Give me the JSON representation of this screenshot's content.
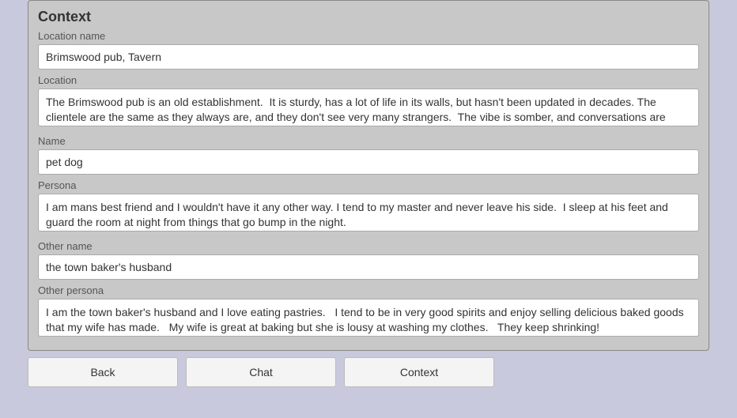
{
  "panel": {
    "title": "Context",
    "fields": {
      "location_name": {
        "label": "Location name",
        "value": "Brimswood pub, Tavern"
      },
      "location": {
        "label": "Location",
        "value": "The Brimswood pub is an old establishment.  It is sturdy, has a lot of life in its walls, but hasn't been updated in decades. The clientele are the same as they always are, and they don't see very many strangers.  The vibe is somber, and conversations are"
      },
      "name": {
        "label": "Name",
        "value": "pet dog"
      },
      "persona": {
        "label": "Persona",
        "value": "I am mans best friend and I wouldn't have it any other way. I tend to my master and never leave his side.  I sleep at his feet and guard the room at night from things that go bump in the night."
      },
      "other_name": {
        "label": "Other name",
        "value": "the town baker's husband"
      },
      "other_persona": {
        "label": "Other persona",
        "value": "I am the town baker's husband and I love eating pastries.   I tend to be in very good spirits and enjoy selling delicious baked goods that my wife has made.   My wife is great at baking but she is lousy at washing my clothes.   They keep shrinking!"
      }
    }
  },
  "buttons": {
    "back": "Back",
    "chat": "Chat",
    "context": "Context"
  }
}
